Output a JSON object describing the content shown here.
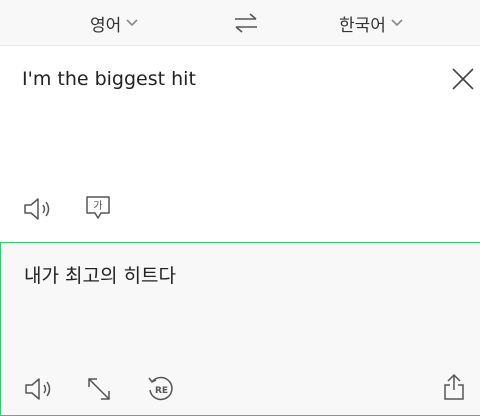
{
  "header": {
    "source_language": "영어",
    "target_language": "한국어"
  },
  "source": {
    "text": "I'm the biggest hit",
    "phonetic_badge": "가"
  },
  "target": {
    "text": "내가 최고의 히트다",
    "retranslate_badge": "RE"
  },
  "colors": {
    "accent_border": "#2fcf6b",
    "icon": "#555555"
  },
  "icons": [
    "chevron-down-icon",
    "swap-icon",
    "close-icon",
    "speaker-icon",
    "phonetic-icon",
    "expand-icon",
    "retranslate-icon",
    "share-icon"
  ]
}
